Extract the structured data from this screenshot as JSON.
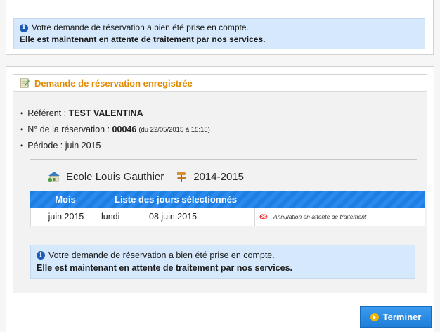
{
  "top_info": {
    "line1": "Votre demande de réservation a bien été prise en compte.",
    "line2": "Elle est maintenant en attente de traitement par nos services."
  },
  "card": {
    "title": "Demande de réservation enregistrée",
    "referent_label": "Référent :",
    "referent_value": "TEST VALENTINA",
    "reservation_label": "N° de la réservation :",
    "reservation_value": "00046",
    "reservation_date": "(du 22/05/2015 à 15:15)",
    "periode_label": "Période :",
    "periode_value": "juin 2015",
    "school": "Ecole Louis Gauthier",
    "year": "2014-2015"
  },
  "table": {
    "headers": [
      "Mois",
      "Liste des jours sélectionnés"
    ],
    "rows": [
      {
        "month": "juin 2015",
        "day": "lundi",
        "date": "08 juin 2015",
        "status": "Annulation en attente de traitement"
      }
    ]
  },
  "bottom_info": {
    "line1": "Votre demande de réservation a bien été prise en compte.",
    "line2": "Elle est maintenant en attente de traitement par nos services."
  },
  "button": {
    "label": "Terminer"
  },
  "colors": {
    "accent": "#1e7fe0",
    "title": "#e08a00",
    "info_bg": "#d6e8fb"
  },
  "icons": [
    "info-icon",
    "note-icon",
    "school-icon",
    "signpost-icon",
    "cancel-icon",
    "arrow-right-icon"
  ]
}
